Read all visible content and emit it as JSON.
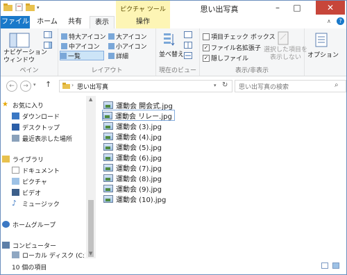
{
  "window": {
    "title": "思い出写真",
    "contextual_tab_group": "ピクチャ ツール"
  },
  "tabs": [
    "ファイル",
    "ホーム",
    "共有",
    "表示",
    "操作"
  ],
  "ribbon": {
    "pane": {
      "button": "ナビゲーション\nウィンドウ",
      "label": "ペイン"
    },
    "layout": {
      "items": [
        "特大アイコン",
        "大アイコン",
        "中アイコン",
        "小アイコン",
        "一覧",
        "詳細"
      ],
      "label": "レイアウト"
    },
    "current_view": {
      "sort_button": "並べ替え",
      "label": "現在のビュー"
    },
    "show_hide": {
      "checkboxes": [
        {
          "label": "項目チェック ボックス",
          "checked": false
        },
        {
          "label": "ファイル名拡張子",
          "checked": true
        },
        {
          "label": "隠しファイル",
          "checked": true
        }
      ],
      "hide_selected": "選択した項目を\n表示しない",
      "label": "表示/非表示"
    },
    "options": "オプション"
  },
  "address": {
    "path": "思い出写真",
    "search_placeholder": "思い出写真の検索"
  },
  "nav": [
    "お気に入り",
    "ダウンロード",
    "デスクトップ",
    "最近表示した場所",
    "ライブラリ",
    "ドキュメント",
    "ピクチャ",
    "ビデオ",
    "ミュージック",
    "ホームグループ",
    "コンピューター",
    "ローカル ディスク (C:)"
  ],
  "files": [
    "運動会 開会式.jpg",
    "運動会 リレー.jpg",
    "運動会 (3).jpg",
    "運動会 (4).jpg",
    "運動会 (5).jpg",
    "運動会 (6).jpg",
    "運動会 (7).jpg",
    "運動会 (8).jpg",
    "運動会 (9).jpg",
    "運動会 (10).jpg"
  ],
  "status": {
    "item_count": "10 個の項目"
  },
  "colors": {
    "file_tab": "#1979ca",
    "contextual_tab": "#fdf5b5",
    "close_button": "#c7463a",
    "selection_border": "#84acdd"
  }
}
